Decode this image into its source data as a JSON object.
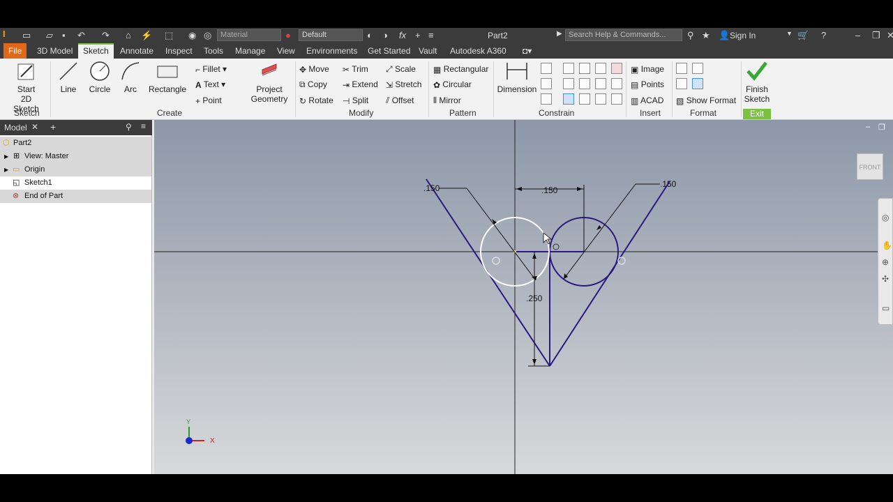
{
  "titlebar": {
    "material_placeholder": "Material",
    "appearance": "Default",
    "doc_title": "Part2",
    "search_placeholder": "Search Help & Commands...",
    "sign_in": "Sign In"
  },
  "tabs": [
    "File",
    "3D Model",
    "Sketch",
    "Annotate",
    "Inspect",
    "Tools",
    "Manage",
    "View",
    "Environments",
    "Get Started",
    "Vault",
    "Autodesk A360"
  ],
  "ribbon": {
    "sketch_panel": {
      "start": "Start",
      "start2": "2D Sketch",
      "label": "Sketch"
    },
    "create_panel": {
      "line": "Line",
      "circle": "Circle",
      "arc": "Arc",
      "rectangle": "Rectangle",
      "fillet": "Fillet",
      "text": "Text",
      "point": "Point",
      "project": "Project",
      "project2": "Geometry",
      "label": "Create"
    },
    "modify_panel": {
      "move": "Move",
      "copy": "Copy",
      "rotate": "Rotate",
      "trim": "Trim",
      "extend": "Extend",
      "split": "Split",
      "scale": "Scale",
      "stretch": "Stretch",
      "offset": "Offset",
      "label": "Modify"
    },
    "pattern_panel": {
      "rectangular": "Rectangular",
      "circular": "Circular",
      "mirror": "Mirror",
      "label": "Pattern"
    },
    "constrain_panel": {
      "dimension": "Dimension",
      "label": "Constrain"
    },
    "insert_panel": {
      "image": "Image",
      "points": "Points",
      "acad": "ACAD",
      "label": "Insert"
    },
    "format_panel": {
      "show_format": "Show Format",
      "label": "Format"
    },
    "exit_panel": {
      "finish": "Finish",
      "finish2": "Sketch",
      "label": "Exit"
    }
  },
  "browser": {
    "tab": "Model",
    "items": [
      "Part2",
      "View: Master",
      "Origin",
      "Sketch1",
      "End of Part"
    ]
  },
  "viewport": {
    "viewcube": "FRONT",
    "dims": {
      "d1": ".150",
      "d2": ".150",
      "d3": ".150",
      "d4": ".250"
    },
    "axis_y": "Y",
    "axis_x": "X"
  },
  "colors": {
    "sketch": "#2a1a80",
    "file_tab": "#e06818",
    "accent": "#7bc243"
  }
}
